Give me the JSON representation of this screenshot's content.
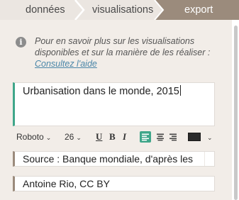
{
  "tabs": [
    {
      "label": "données"
    },
    {
      "label": "visualisations"
    },
    {
      "label": "export"
    }
  ],
  "info": {
    "line1": "Pour en savoir plus sur les visualisations",
    "line2": "disponibles et sur la manière de les réaliser :",
    "link": "Consultez l'aide"
  },
  "title_field": {
    "value": "Urbanisation dans le monde, 2015"
  },
  "toolbar": {
    "font": "Roboto",
    "size": "26",
    "underline": "U",
    "bold": "B",
    "italic": "I",
    "text_color": "#2b2b2b"
  },
  "source_field": {
    "value": "Source : Banque mondiale, d'après les"
  },
  "author_field": {
    "value": "Antoine Rio, CC BY"
  },
  "colors": {
    "accent": "#3fa68a",
    "active_tab": "#9b8b7c",
    "panel": "#f2ede8",
    "link": "#4a86a8"
  }
}
